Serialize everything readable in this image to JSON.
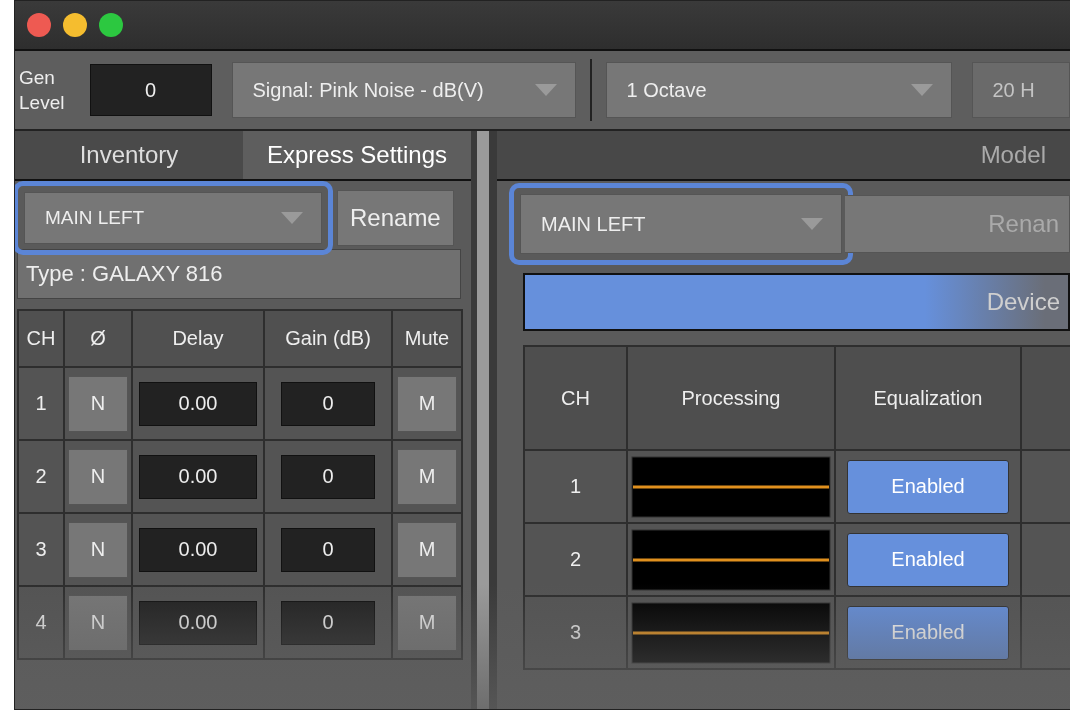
{
  "toolbar": {
    "gen_level_label": "Gen Level",
    "gen_level_value": "0",
    "signal": "Signal: Pink Noise - dB(V)",
    "bandwidth": "1 Octave",
    "range": "20 H"
  },
  "left_panel": {
    "tabs": [
      {
        "label": "Inventory",
        "selected": false
      },
      {
        "label": "Express Settings",
        "selected": true
      }
    ],
    "speaker": {
      "value": "MAIN LEFT",
      "highlighted": true
    },
    "rename": "Rename",
    "type": "Type : GALAXY 816",
    "columns": [
      "CH",
      "Ø",
      "Delay",
      "Gain (dB)",
      "Mute"
    ],
    "rows": [
      {
        "ch": "1",
        "polarity": "N",
        "delay": "0.00",
        "gain": "0",
        "mute": "M"
      },
      {
        "ch": "2",
        "polarity": "N",
        "delay": "0.00",
        "gain": "0",
        "mute": "M"
      },
      {
        "ch": "3",
        "polarity": "N",
        "delay": "0.00",
        "gain": "0",
        "mute": "M"
      },
      {
        "ch": "4",
        "polarity": "N",
        "delay": "0.00",
        "gain": "0",
        "mute": "M"
      }
    ]
  },
  "right_panel": {
    "tab": "Model",
    "speaker": {
      "value": "MAIN LEFT",
      "highlighted": true
    },
    "rename": "Renan",
    "banner": "Device",
    "columns": [
      "CH",
      "Processing",
      "Equalization"
    ],
    "rows": [
      {
        "ch": "1",
        "equalization": "Enabled"
      },
      {
        "ch": "2",
        "equalization": "Enabled"
      },
      {
        "ch": "3",
        "equalization": "Enabled"
      }
    ]
  }
}
